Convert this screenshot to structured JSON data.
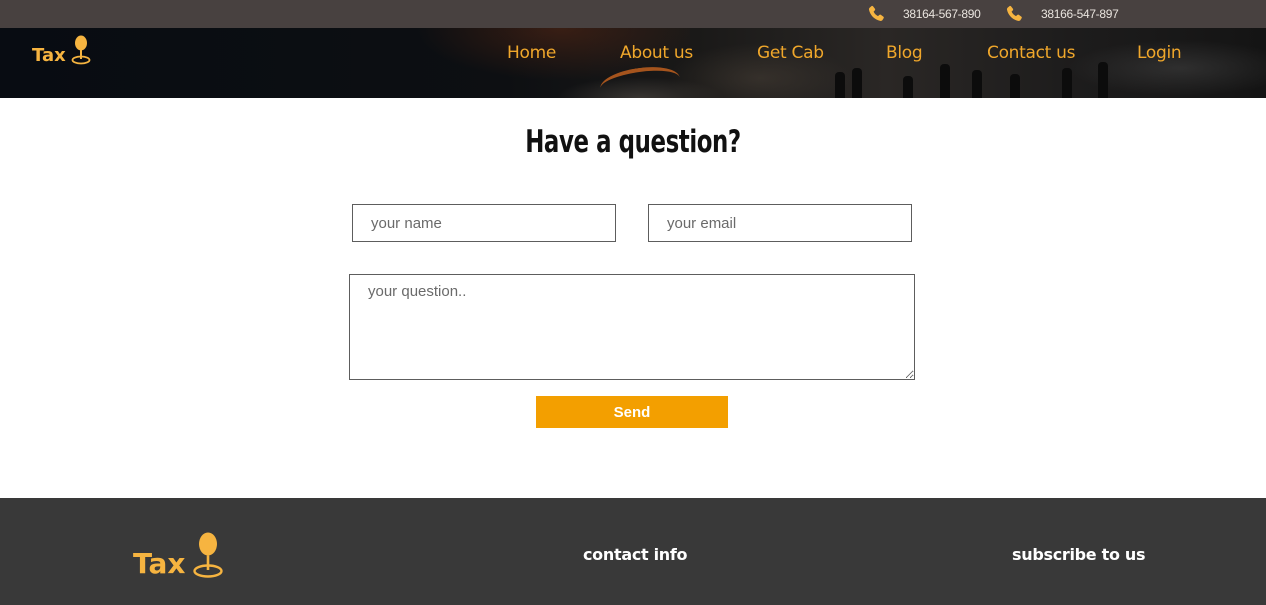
{
  "topbar": {
    "phones": [
      {
        "icon": "phone-icon",
        "number": "38164-567-890"
      },
      {
        "icon": "phone-icon",
        "number": "38166-547-897"
      }
    ]
  },
  "brand": {
    "name": "Tax",
    "icon": "map-pin-icon"
  },
  "nav": {
    "items": [
      "Home",
      "About us",
      "Get Cab",
      "Blog",
      "Contact us",
      "Login"
    ]
  },
  "form": {
    "title": "Have a question?",
    "name_placeholder": "your name",
    "email_placeholder": "your email",
    "question_placeholder": "your question..",
    "send_label": "Send"
  },
  "footer": {
    "contact_heading": "contact info",
    "subscribe_heading": "subscribe to us"
  },
  "colors": {
    "accent": "#f39f00",
    "nav_text": "#f0a72b",
    "topbar": "#484140",
    "footer": "#393939"
  }
}
